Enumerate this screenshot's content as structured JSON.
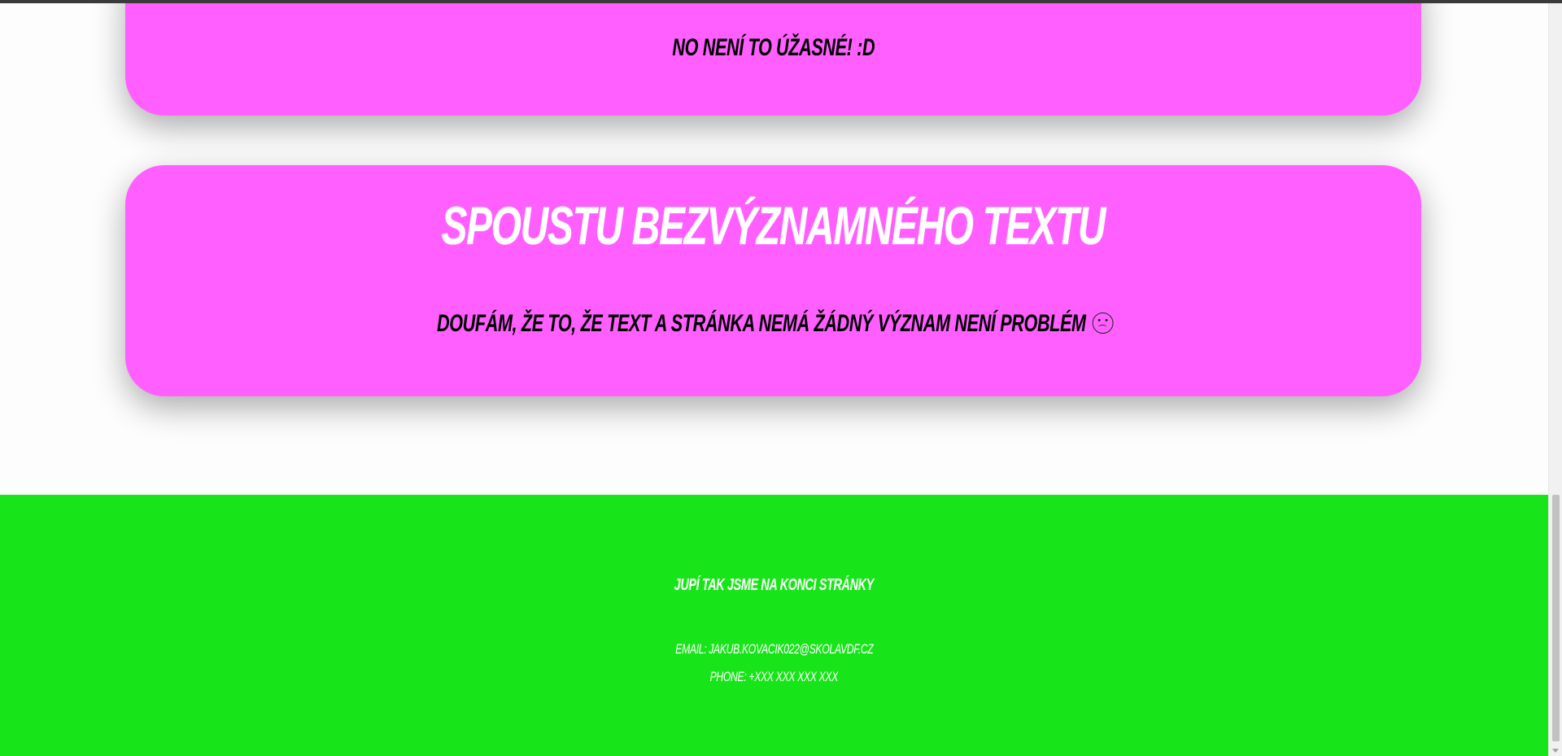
{
  "cards": {
    "top_text": "No není to úžasné! :D",
    "bottom_title": "Spoustu bezvýznamného textu",
    "bottom_text": "Doufám, že to, že text a stránka nemá žádný význam není problém"
  },
  "icons": {
    "sad_face": "sad-face-icon"
  },
  "footer": {
    "title": "Jupí tak jsme na konci stránky",
    "email": "Email: jakub.kovacik022@skolavdf.cz",
    "phone": "Phone: +xxx xxx xxx xxx"
  },
  "colors": {
    "card": "#ff5fff",
    "footer": "#18e519",
    "background": "#fdfdfd"
  }
}
